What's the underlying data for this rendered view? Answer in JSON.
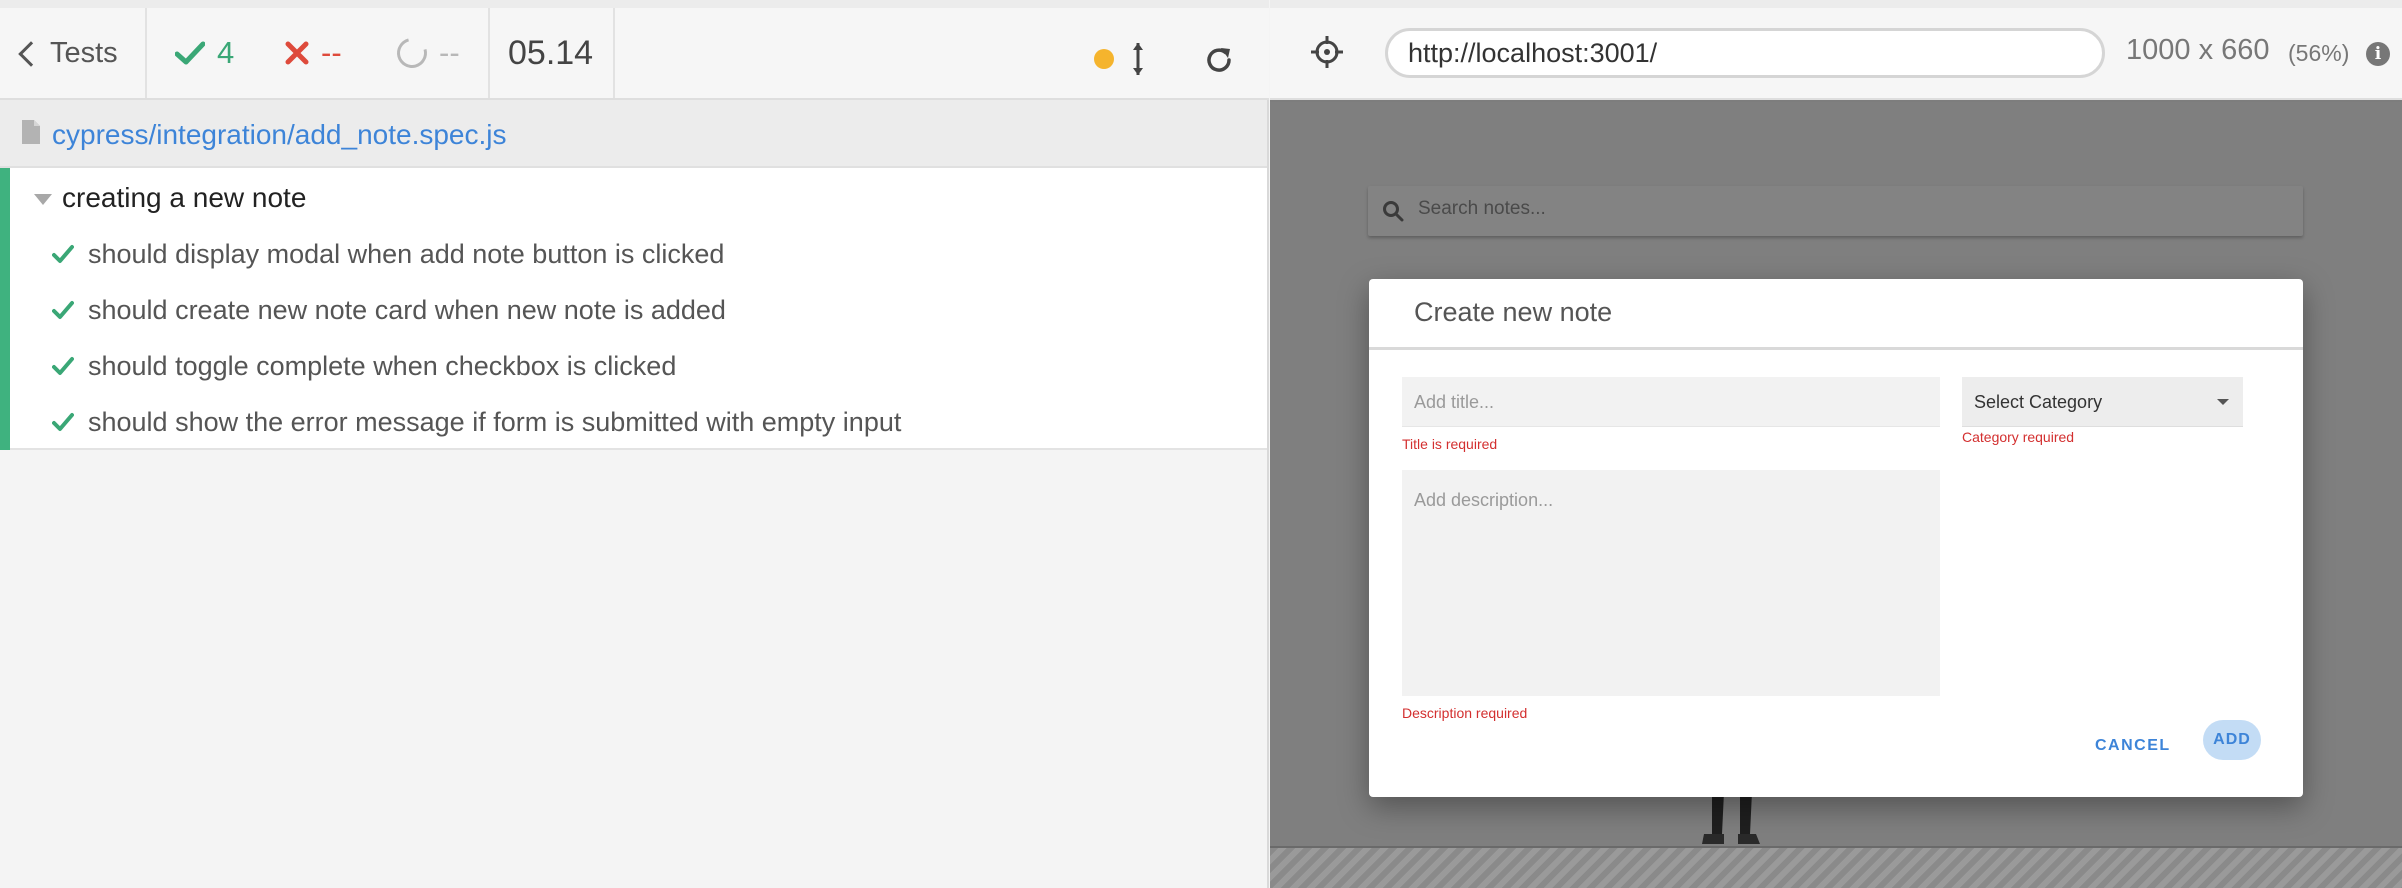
{
  "reporter": {
    "tests_label": "Tests",
    "passed_count": "4",
    "failed_count": "--",
    "pending_count": "--",
    "duration": "05.14",
    "status_color": "#f5b42d",
    "spec_path": "cypress/integration/add_note.spec.js",
    "suite": {
      "title": "creating a new note",
      "tests": [
        {
          "label": "should display modal when add note button is clicked",
          "state": "passed"
        },
        {
          "label": "should create new note card when new note is added",
          "state": "passed"
        },
        {
          "label": "should toggle complete when checkbox is clicked",
          "state": "passed"
        },
        {
          "label": "should show the error message if form is submitted with empty input",
          "state": "passed"
        }
      ]
    }
  },
  "aut": {
    "url": "http://localhost:3001/",
    "viewport_size": "1000 x 660",
    "viewport_scale": "(56%)",
    "info_icon_glyph": "i",
    "search_placeholder": "Search notes...",
    "modal": {
      "title": "Create new note",
      "title_placeholder": "Add title...",
      "title_error": "Title is required",
      "category_value": "Select Category",
      "category_error": "Category required",
      "description_placeholder": "Add description...",
      "description_error": "Description required",
      "cancel_label": "CANCEL",
      "add_label": "ADD"
    }
  },
  "colors": {
    "passed": "#3aa776",
    "failed": "#de4a3b",
    "link": "#3d84d8",
    "error": "#d32f2f"
  }
}
